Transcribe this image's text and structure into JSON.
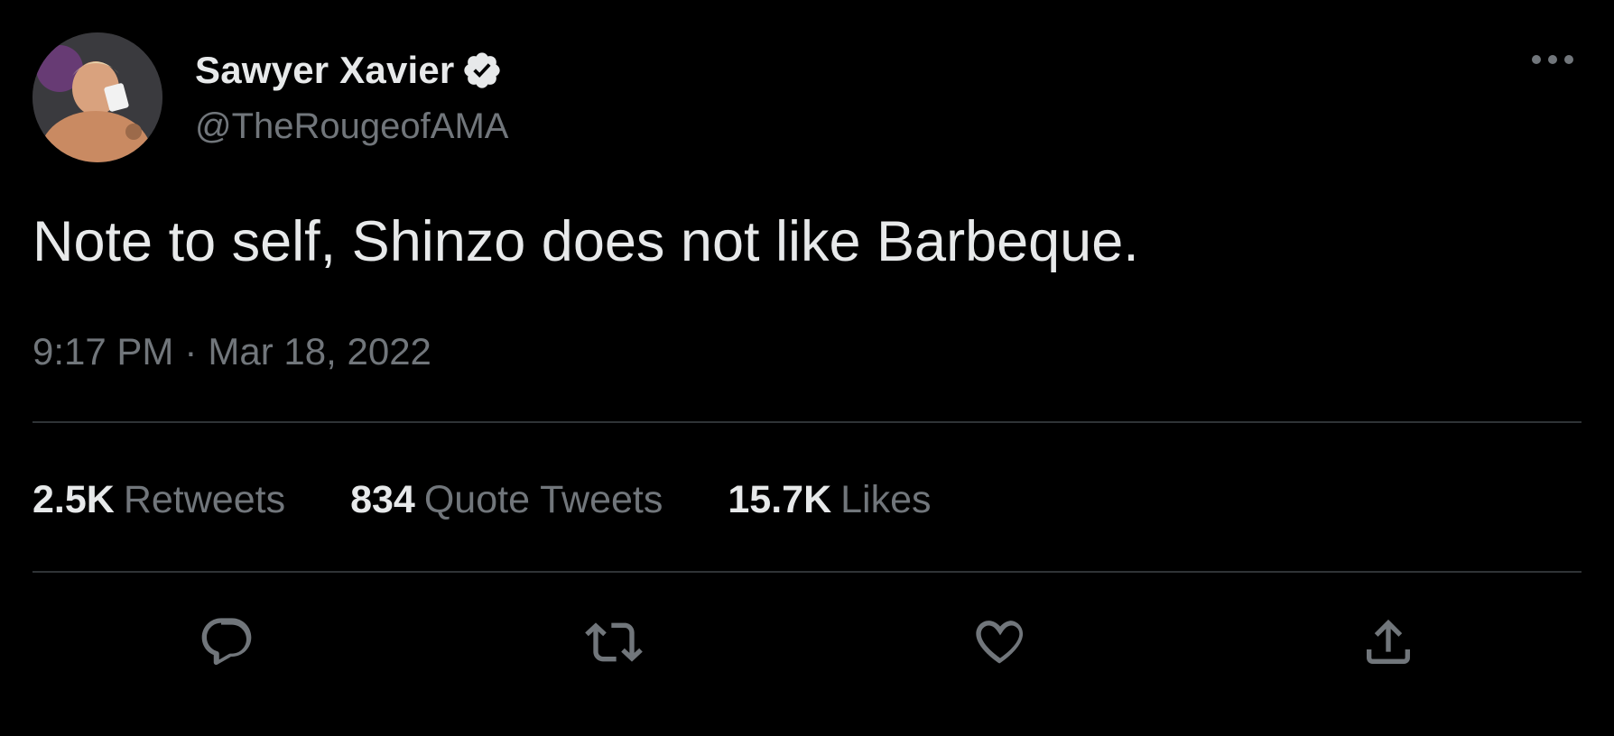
{
  "author": {
    "display_name": "Sawyer Xavier",
    "handle": "@TheRougeofAMA",
    "verified": true,
    "avatar_icon": "profile-photo"
  },
  "tweet": {
    "text": "Note to self, Shinzo does not like Barbeque.",
    "time": "9:17 PM",
    "separator": "·",
    "date": "Mar 18, 2022"
  },
  "stats": {
    "retweets": {
      "value": "2.5K",
      "label": "Retweets"
    },
    "quote_tweets": {
      "value": "834",
      "label": "Quote Tweets"
    },
    "likes": {
      "value": "15.7K",
      "label": "Likes"
    }
  },
  "actions": {
    "reply_icon": "reply-icon",
    "retweet_icon": "retweet-icon",
    "like_icon": "heart-icon",
    "share_icon": "share-icon",
    "more_icon": "more-dots-icon"
  },
  "colors": {
    "background": "#000000",
    "primary_text": "#e7e9ea",
    "secondary_text": "#71767b",
    "divider": "#2f3336"
  }
}
